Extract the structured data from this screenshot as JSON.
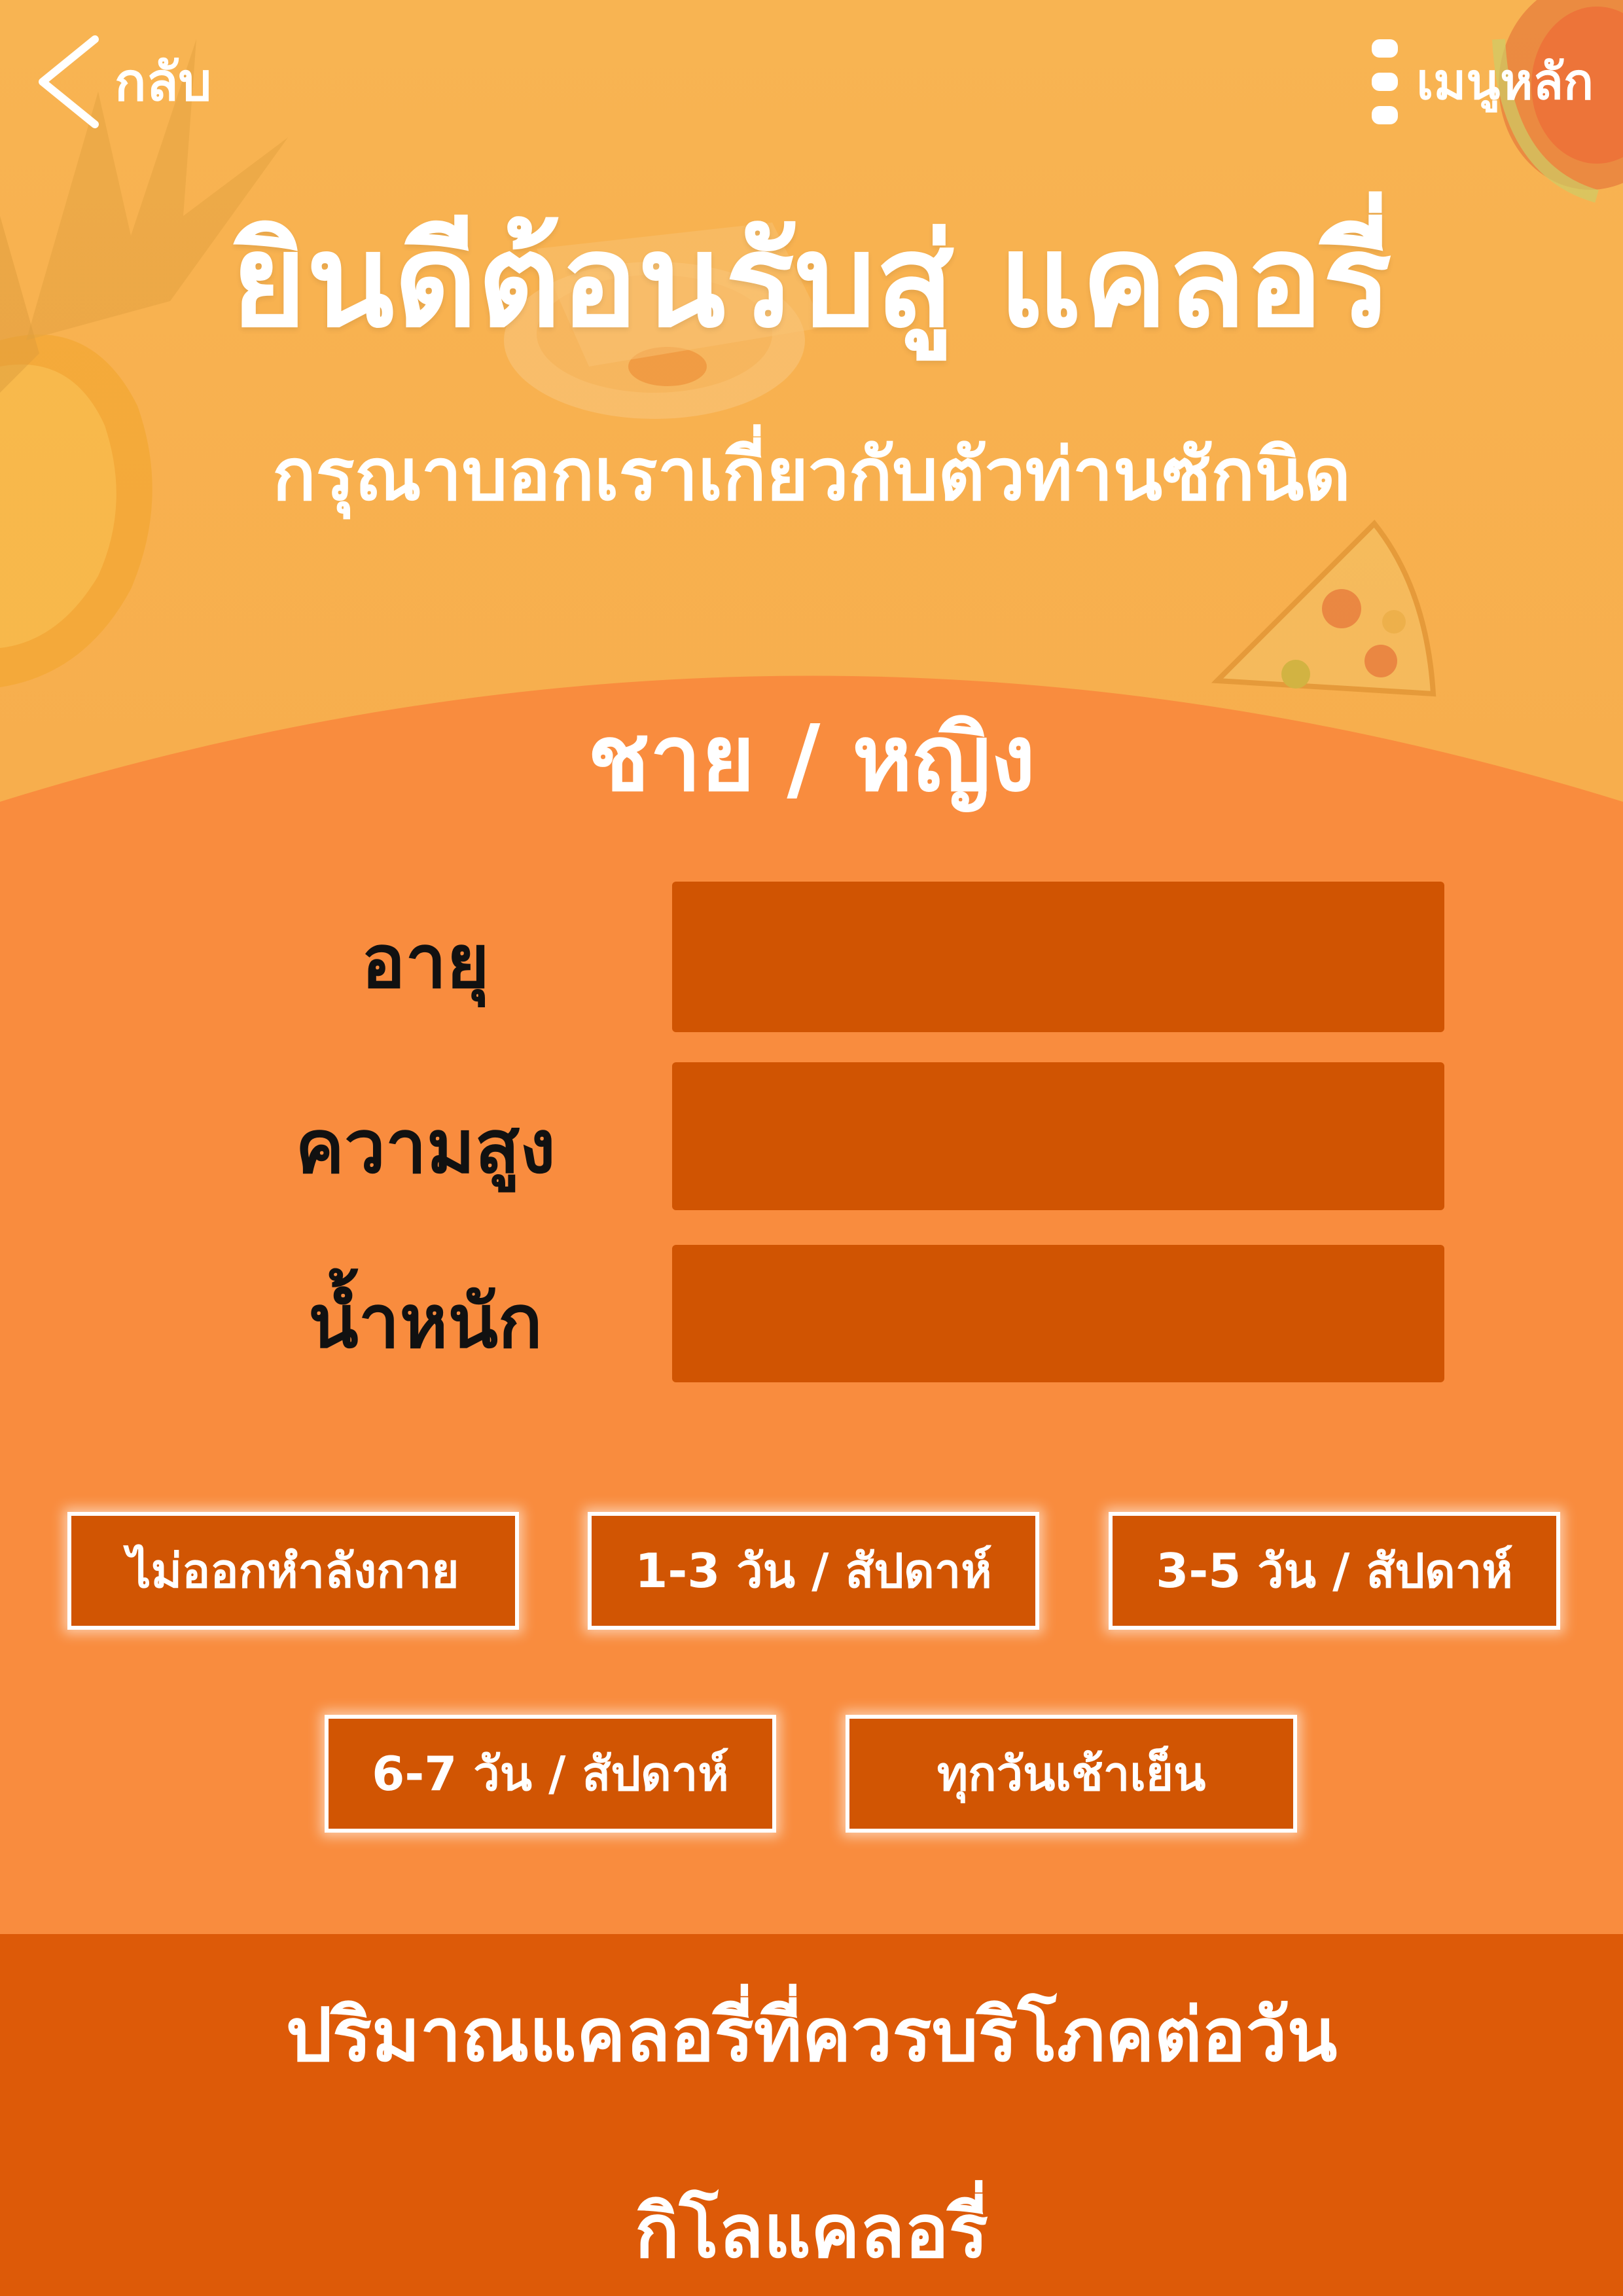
{
  "nav": {
    "back_label": "กลับ",
    "menu_label": "เมนูหลัก"
  },
  "header": {
    "title": "ยินดีต้อนรับสู่ แคลอรี่",
    "subtitle": "กรุณาบอกเราเกี่ยวกับตัวท่านซักนิด"
  },
  "form": {
    "gender_label": "ชาย / หญิง",
    "fields": [
      {
        "label": "อายุ",
        "value": ""
      },
      {
        "label": "ความสูง",
        "value": ""
      },
      {
        "label": "น้ำหนัก",
        "value": ""
      }
    ]
  },
  "activity_options": [
    "ไม่ออกหำลังกาย",
    "1-3 วัน / สัปดาห์",
    "3-5 วัน / สัปดาห์",
    "6-7 วัน / สัปดาห์",
    "ทุกวันเช้าเย็น"
  ],
  "result": {
    "title": "ปริมาณแคลอรี่ที่ควรบริโภคต่อวัน",
    "unit": "กิโลแคลอรี่"
  },
  "colors": {
    "background": "#f8b452",
    "panel": "#f98c3e",
    "input": "#d05402",
    "result_bar": "#dd5a08"
  },
  "icons": [
    "chevron-left-icon",
    "vertical-dots-icon"
  ]
}
